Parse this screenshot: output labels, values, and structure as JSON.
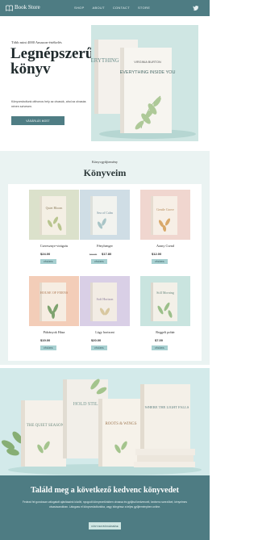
{
  "nav": {
    "logo": "Book Store",
    "links": [
      "SHOP",
      "ABOUT",
      "CONTACT",
      "STORE"
    ],
    "social_icon": "twitter-icon"
  },
  "hero": {
    "kicker": "Több mint 4000 Amazon-értékelés",
    "title": "Legnépszerűbb könyv",
    "description": "Könyvesboltunk otthonos hely az olvasók, ahol az olvasás néven szívesen.",
    "button": "VÁSÁRLÁS MOST",
    "book_front_author": "VIRGINIA BURTON",
    "book_front_title": "EVERYTHING INSIDE YOU",
    "book_back_title": "EVERYTHING INSIDE YOU"
  },
  "collection": {
    "kicker": "Könyvgyűjtemény",
    "title": "Könyveim",
    "books": [
      {
        "name": "Cseresznye-virágzás",
        "old_price": "",
        "price": "$24.00",
        "button": "VÁSÁROL",
        "cover": "Quiet Bloom"
      },
      {
        "name": "Fényhenger",
        "old_price": "$13.90",
        "price": "$17.80",
        "button": "VÁSÁROL",
        "cover": "Sea of Calm"
      },
      {
        "name": "Arany Csend",
        "old_price": "",
        "price": "$12.00",
        "button": "VÁSÁROL",
        "cover": "Gentle Grove"
      },
      {
        "name": "Páfrányok Háza",
        "old_price": "",
        "price": "$19.00",
        "button": "VÁSÁROL",
        "cover": "HOUSE OF FERNS"
      },
      {
        "name": "Lágy horizont",
        "old_price": "",
        "price": "$20.00",
        "button": "VÁSÁROL",
        "cover": "Soft Horizon"
      },
      {
        "name": "Reggeli pohár",
        "old_price": "",
        "price": "$7.00",
        "button": "VÁSÁROL",
        "cover": "Still Morning"
      }
    ]
  },
  "showcase": {
    "books": [
      "THE QUIET SEASON",
      "HOLD STILL",
      "ROOTS & WINGS",
      "WHERE THE LIGHT FALLS"
    ]
  },
  "footer": {
    "title": "Találd meg a következő kedvenc könyvedet",
    "text": "Fedezd fel gondosan válogatott ajánlásaink között, nyugodt környezetünkben olvassa és gyűjtsd kedvenceit, kedvenc szerzőket, kényelmes olvasósarokban. Látogass el könyvesboltunkba, vagy böngéssz a teljes gyűjteményben online.",
    "button": "KÖNYVEK BÖNGÉSZÉSE"
  },
  "colors": {
    "primary": "#4e7c83",
    "light": "#eaf3f2",
    "accent": "#a7d0d1"
  }
}
